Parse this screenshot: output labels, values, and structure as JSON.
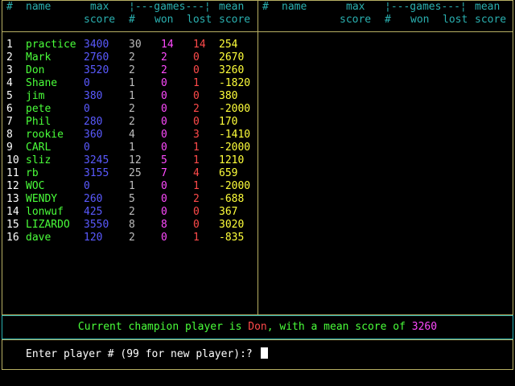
{
  "headers": {
    "row1": {
      "hash": "#",
      "name": "name",
      "max": "max",
      "games": "¦---games---¦",
      "mean": "mean"
    },
    "row2": {
      "score": "score",
      "hash": "#",
      "won": "won",
      "lost": "lost",
      "score2": "score"
    }
  },
  "players": [
    {
      "num": "1",
      "name": "practice",
      "max": "3400",
      "games": "30",
      "won": "14",
      "lost": "14",
      "mean": "254"
    },
    {
      "num": "2",
      "name": "Mark",
      "max": "2760",
      "games": "2",
      "won": "2",
      "lost": "0",
      "mean": "2670"
    },
    {
      "num": "3",
      "name": "Don",
      "max": "3520",
      "games": "2",
      "won": "2",
      "lost": "0",
      "mean": "3260"
    },
    {
      "num": "4",
      "name": "Shane",
      "max": "0",
      "games": "1",
      "won": "0",
      "lost": "1",
      "mean": "-1820"
    },
    {
      "num": "5",
      "name": "jim",
      "max": "380",
      "games": "1",
      "won": "0",
      "lost": "0",
      "mean": "380"
    },
    {
      "num": "6",
      "name": "pete",
      "max": "0",
      "games": "2",
      "won": "0",
      "lost": "2",
      "mean": "-2000"
    },
    {
      "num": "7",
      "name": "Phil",
      "max": "280",
      "games": "2",
      "won": "0",
      "lost": "0",
      "mean": "170"
    },
    {
      "num": "8",
      "name": "rookie",
      "max": "360",
      "games": "4",
      "won": "0",
      "lost": "3",
      "mean": "-1410"
    },
    {
      "num": "9",
      "name": "CARL",
      "max": "0",
      "games": "1",
      "won": "0",
      "lost": "1",
      "mean": "-2000"
    },
    {
      "num": "10",
      "name": "sliz",
      "max": "3245",
      "games": "12",
      "won": "5",
      "lost": "1",
      "mean": "1210"
    },
    {
      "num": "11",
      "name": "rb",
      "max": "3155",
      "games": "25",
      "won": "7",
      "lost": "4",
      "mean": "659"
    },
    {
      "num": "12",
      "name": "WOC",
      "max": "0",
      "games": "1",
      "won": "0",
      "lost": "1",
      "mean": "-2000"
    },
    {
      "num": "13",
      "name": "WENDY",
      "max": "260",
      "games": "5",
      "won": "0",
      "lost": "2",
      "mean": "-688"
    },
    {
      "num": "14",
      "name": "lonwuf",
      "max": "425",
      "games": "2",
      "won": "0",
      "lost": "0",
      "mean": "367"
    },
    {
      "num": "15",
      "name": "LIZARDO",
      "max": "3550",
      "games": "8",
      "won": "8",
      "lost": "0",
      "mean": "3020"
    },
    {
      "num": "16",
      "name": "dave",
      "max": "120",
      "games": "2",
      "won": "0",
      "lost": "1",
      "mean": "-835"
    }
  ],
  "champion": {
    "prefix": "Current champion player is ",
    "name": "Don",
    "middle": ", with a mean score of ",
    "score": "3260"
  },
  "prompt": {
    "text": "Enter player # (99 for new player):? "
  },
  "colors": {
    "border": "#b8b064",
    "header": "#2ab0b0",
    "name": "#4aff3a",
    "max_score": "#5a5aff",
    "games": "#bdbdbd",
    "won": "#ff4aff",
    "lost": "#ff4a4a",
    "mean": "#ffff3a"
  }
}
